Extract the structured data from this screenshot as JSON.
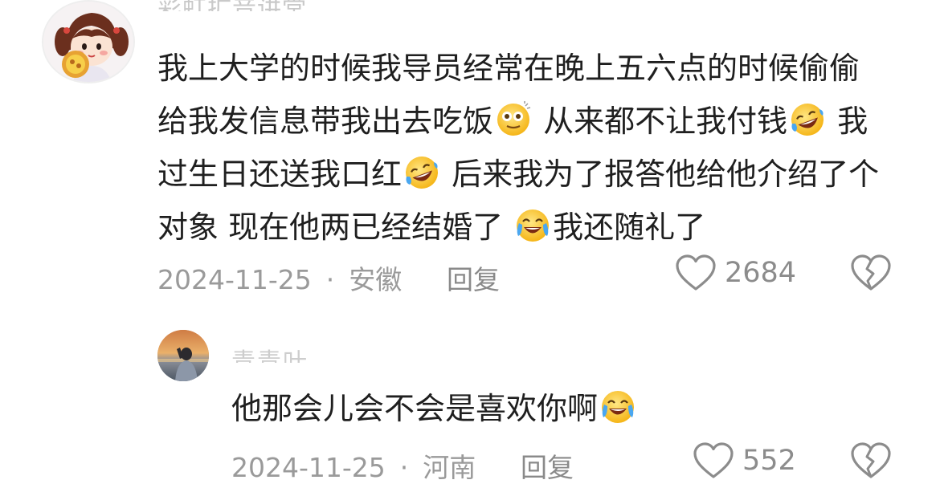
{
  "main_comment": {
    "username": "彩虹扩音讲堂",
    "text_lines": [
      "我上大学的时候我导员经常在晚上五六点的时候偷偷",
      "给我发信息带我出去吃饭",
      " 从来都不让我付钱",
      " 我",
      "过生日还送我口红",
      " 后来我为了报答他给他介绍了个",
      "对象 现在他两已经结婚了 ",
      "我还随礼了"
    ],
    "date": "2024-11-25",
    "separator": "·",
    "location": "安徽",
    "reply_label": "回复",
    "like_count": "2684"
  },
  "reply_comment": {
    "username": "青青叶",
    "text": "他那会儿会不会是喜欢你啊",
    "date": "2024-11-25",
    "separator": "·",
    "location": "河南",
    "reply_label": "回复",
    "like_count": "552"
  },
  "icons": {
    "like": "heart-outline-icon",
    "dislike": "broken-heart-icon",
    "emoji_dizzy": "dizzy-face-emoji-icon",
    "emoji_laugh": "rolling-laughing-emoji-icon",
    "emoji_cry": "crying-laughing-emoji-icon"
  },
  "colors": {
    "text": "#1f1f1f",
    "meta": "#9a9a9a",
    "icon_stroke": "#8c8c8c"
  }
}
